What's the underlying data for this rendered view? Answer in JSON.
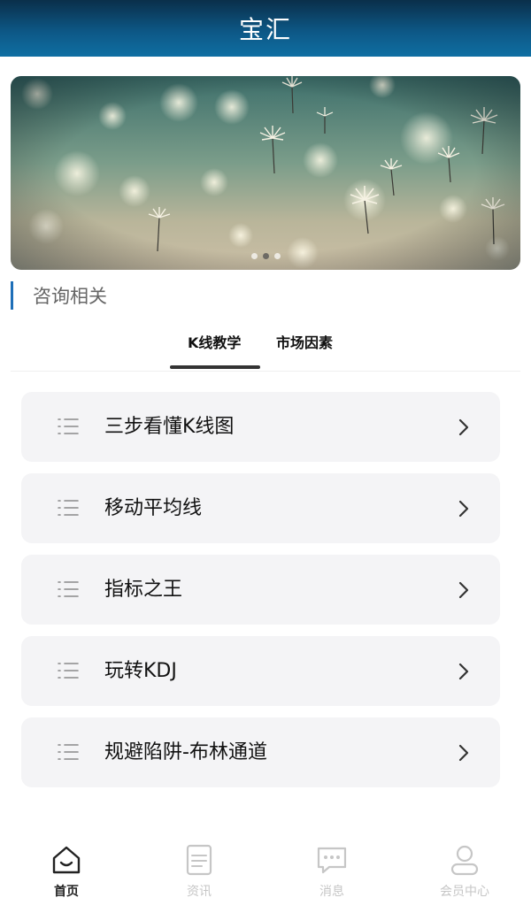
{
  "header": {
    "title": "宝汇"
  },
  "banner": {
    "slide_count": 3,
    "active_slide": 2
  },
  "section": {
    "title": "咨询相关"
  },
  "tabs": [
    {
      "label": "K线教学",
      "active": true
    },
    {
      "label": "市场因素",
      "active": false
    }
  ],
  "list": {
    "items": [
      {
        "label": "三步看懂K线图",
        "icon": "list-icon"
      },
      {
        "label": "移动平均线",
        "icon": "list-icon"
      },
      {
        "label": "指标之王",
        "icon": "list-icon"
      },
      {
        "label": "玩转KDJ",
        "icon": "list-icon"
      },
      {
        "label": "规避陷阱-布林通道",
        "icon": "list-icon"
      }
    ]
  },
  "bottom_nav": {
    "items": [
      {
        "label": "首页",
        "icon": "home-icon",
        "active": true
      },
      {
        "label": "资讯",
        "icon": "news-icon",
        "active": false
      },
      {
        "label": "消息",
        "icon": "message-icon",
        "active": false
      },
      {
        "label": "会员中心",
        "icon": "user-icon",
        "active": false
      }
    ]
  },
  "colors": {
    "header_top": "#0a2f4a",
    "header_bottom": "#0f6fa3",
    "section_accent": "#1e6fb8",
    "card_bg": "#f4f4f6",
    "nav_inactive": "#c6c6c6"
  }
}
